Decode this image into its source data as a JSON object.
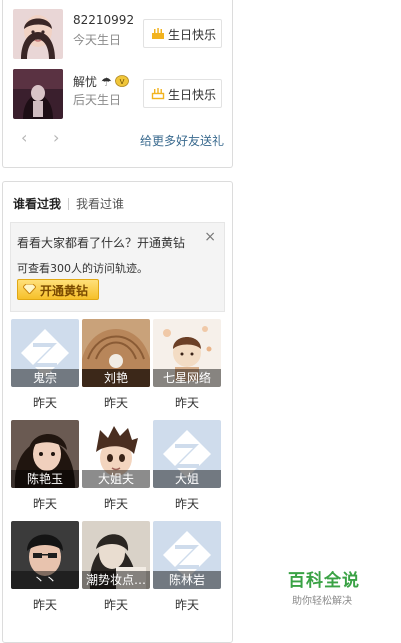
{
  "birthday": {
    "friends": [
      {
        "name": "82210992",
        "when": "今天生日",
        "button": "生日快乐",
        "avatar_icon": "girl-portrait"
      },
      {
        "name": "解忧",
        "when": "后天生日",
        "button": "生日快乐",
        "avatar_icon": "girl-dark-portrait",
        "badges": [
          "umbrella-icon",
          "vip-badge-icon"
        ]
      }
    ],
    "prev_icon": "chevron-left",
    "next_icon": "chevron-right",
    "send_gift_link": "给更多好友送礼"
  },
  "visitors": {
    "tab_active": "谁看过我",
    "tab_other": "我看过谁",
    "promo": {
      "line1": "看看大家都看了什么？开通黄钻",
      "line2": "可查看300人的访问轨迹。",
      "button": "开通黄钻",
      "close": "×"
    },
    "list": [
      {
        "name": "鬼宗",
        "time": "昨天",
        "thumb": "default-qzone-avatar"
      },
      {
        "name": "刘艳",
        "time": "昨天",
        "thumb": "shell-pearl-photo"
      },
      {
        "name": "七星网络",
        "time": "昨天",
        "thumb": "doll-photo"
      },
      {
        "name": "陈艳玉",
        "time": "昨天",
        "thumb": "girl-photo"
      },
      {
        "name": "大姐夫",
        "time": "昨天",
        "thumb": "cartoon-boy"
      },
      {
        "name": "大姐",
        "time": "昨天",
        "thumb": "default-qzone-avatar"
      },
      {
        "name": "丶丶",
        "time": "昨天",
        "thumb": "boy-photo"
      },
      {
        "name": "潮势妆点…",
        "time": "昨天",
        "thumb": "girl-bw-photo"
      },
      {
        "name": "陈林岩",
        "time": "昨天",
        "thumb": "default-qzone-avatar"
      }
    ]
  },
  "watermark": {
    "main": "百科全说",
    "sub": "助你轻松解决"
  }
}
